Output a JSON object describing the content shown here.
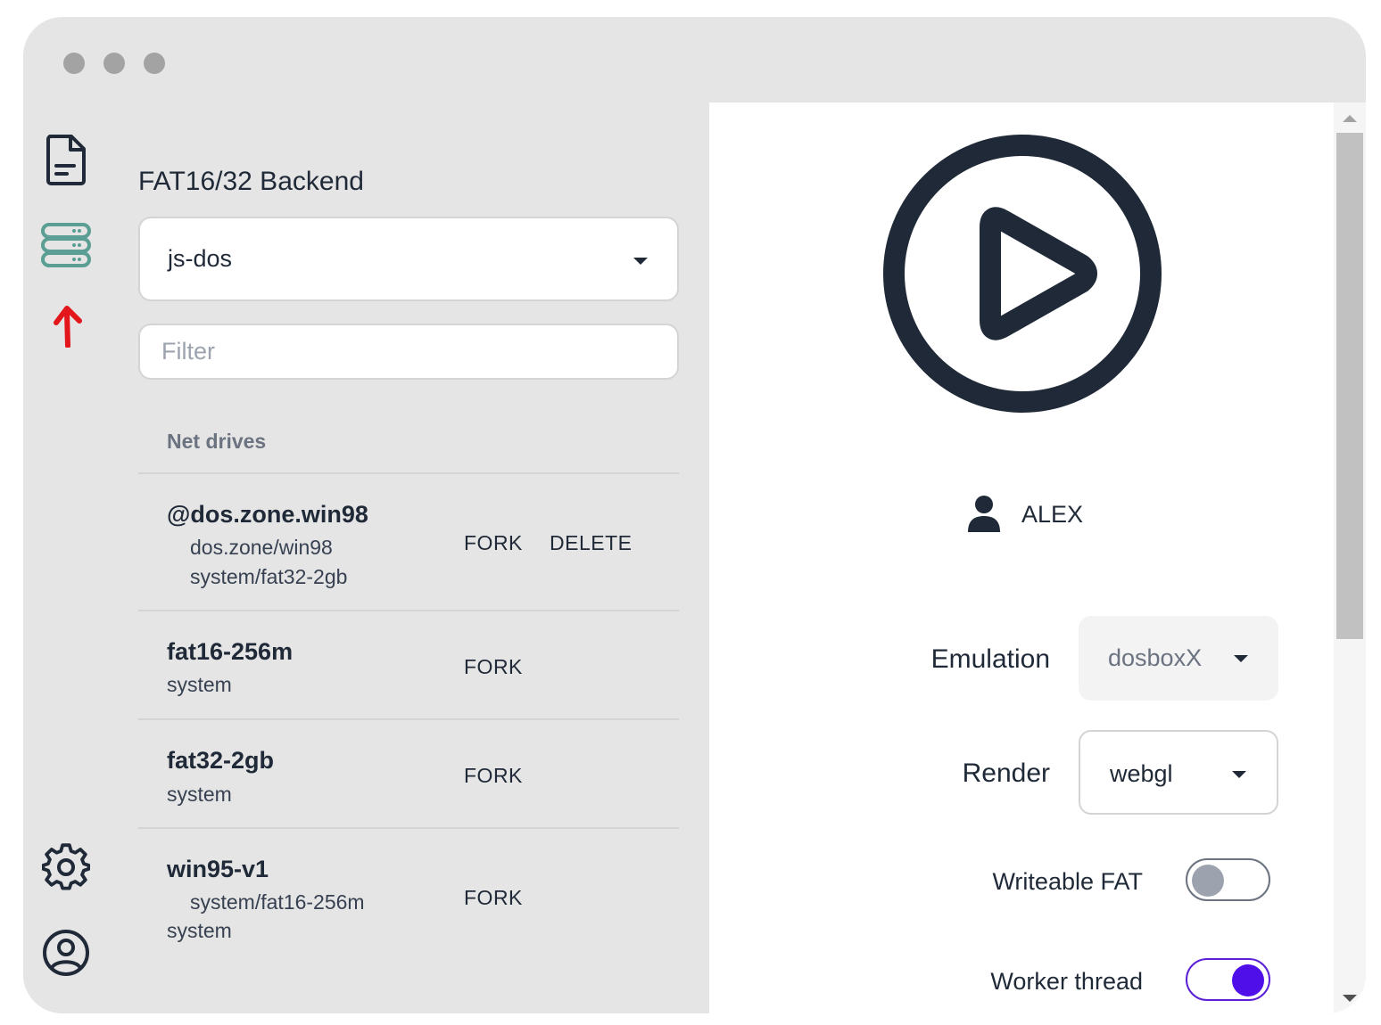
{
  "sidebar": {
    "icons": [
      "document-icon",
      "server-icon",
      "arrow-up-icon",
      "gear-icon",
      "user-circle-icon"
    ],
    "accent_server": "#5a9e94",
    "accent_arrow": "#e3171b"
  },
  "backend": {
    "title": "FAT16/32 Backend",
    "selected": "js-dos",
    "filter_placeholder": "Filter"
  },
  "drives": {
    "header": "Net drives",
    "items": [
      {
        "name": "@dos.zone.win98",
        "sub1": "dos.zone/win98",
        "sub2": "system/fat32-2gb",
        "fork": "FORK",
        "delete": "DELETE"
      },
      {
        "name": "fat16-256m",
        "sub1": "system",
        "fork": "FORK"
      },
      {
        "name": "fat32-2gb",
        "sub1": "system",
        "fork": "FORK"
      },
      {
        "name": "win95-v1",
        "sub1": "system/fat16-256m",
        "sub2": "system",
        "fork": "FORK"
      }
    ]
  },
  "user": {
    "name": "ALEX"
  },
  "settings": {
    "emulation_label": "Emulation",
    "emulation_value": "dosboxX",
    "render_label": "Render",
    "render_value": "webgl",
    "writeable_fat_label": "Writeable FAT",
    "writeable_fat": false,
    "worker_thread_label": "Worker thread",
    "worker_thread": true,
    "toggle_on_color": "#4f0fe8"
  }
}
